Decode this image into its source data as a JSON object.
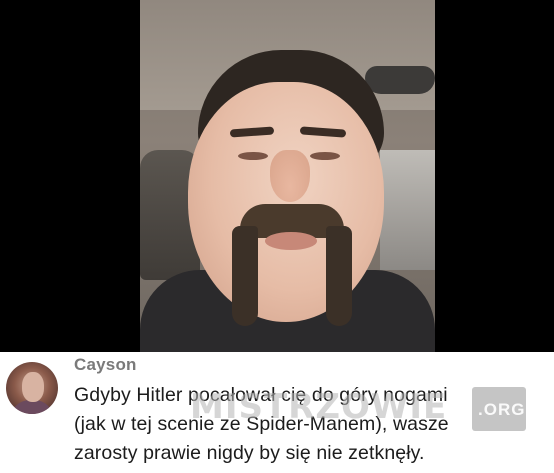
{
  "comment": {
    "username": "Cayson",
    "lines": [
      "Gdyby Hitler pocałował cię do góry nogami",
      "(jak w tej scenie ze Spider-Manem), wasze",
      "zarosty prawie nigdy by się nie zetknęły."
    ]
  },
  "watermark": {
    "name": "MISTRZOWIE",
    "tld": ".ORG"
  },
  "colors": {
    "background": "#ffffff",
    "video_bg": "#000000",
    "username": "#7a7a7a",
    "comment_text": "#1c1c1c"
  }
}
